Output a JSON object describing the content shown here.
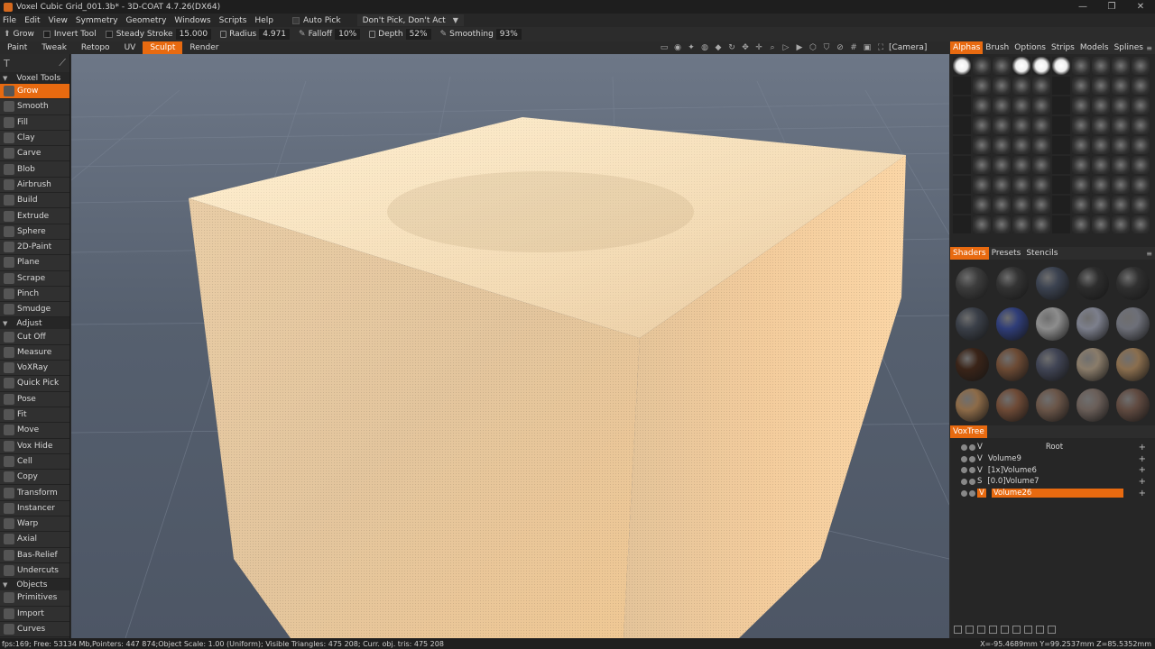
{
  "window": {
    "title": "Voxel Cubic Grid_001.3b* - 3D-COAT 4.7.26(DX64)",
    "controls": [
      "—",
      "❐",
      "✕"
    ]
  },
  "menu": {
    "items": [
      "File",
      "Edit",
      "View",
      "Symmetry",
      "Geometry",
      "Windows",
      "Scripts",
      "Help"
    ],
    "auto_pick": "Auto Pick",
    "pick_mode": "Don't Pick, Don't Act"
  },
  "tool_options": {
    "tool": "Grow",
    "invert_tool": "Invert Tool",
    "steady_stroke_label": "Steady Stroke",
    "steady_stroke_value": "15.000",
    "radius_label": "Radius",
    "radius_value": "4.971",
    "falloff_label": "Falloff",
    "falloff_value": "10%",
    "depth_label": "Depth",
    "depth_value": "52%",
    "smoothing_label": "Smoothing",
    "smoothing_value": "93%"
  },
  "rooms": {
    "tabs": [
      "Paint",
      "Tweak",
      "Retopo",
      "UV",
      "Sculpt",
      "Render"
    ],
    "active": "Sculpt",
    "camera_label": "[Camera]"
  },
  "left_panel": {
    "voxel_tools_header": "Voxel Tools",
    "voxel_tools": [
      "Grow",
      "Smooth",
      "Fill",
      "Clay",
      "Carve",
      "Blob",
      "Airbrush",
      "Build",
      "Extrude",
      "Sphere",
      "2D-Paint",
      "Plane",
      "Scrape",
      "Pinch",
      "Smudge"
    ],
    "selected_tool": "Grow",
    "adjust_header": "Adjust",
    "adjust_tools": [
      "Cut Off",
      "Measure",
      "VoXRay",
      "Quick Pick",
      "Pose",
      "Fit",
      "Move",
      "Vox Hide",
      "Cell",
      "Copy",
      "Transform",
      "Instancer",
      "Warp",
      "Axial",
      "Bas-Relief",
      "Undercuts"
    ],
    "objects_header": "Objects",
    "object_tools": [
      "Primitives",
      "Import",
      "Curves"
    ]
  },
  "right_panel": {
    "top_tabs": [
      "Alphas",
      "Brush",
      "Options",
      "Strips",
      "Models",
      "Splines"
    ],
    "top_active": "Alphas",
    "mid_tabs": [
      "Shaders",
      "Presets",
      "Stencils"
    ],
    "mid_active": "Shaders",
    "voxtree_tab": "VoxTree",
    "voxtree": [
      {
        "flag": "V",
        "name": "Root",
        "root": true
      },
      {
        "flag": "V",
        "name": "Volume9"
      },
      {
        "flag": "V",
        "name": "[1x]Volume6"
      },
      {
        "flag": "S",
        "name": "[0.0]Volume7"
      },
      {
        "flag": "V",
        "name": "Volume26",
        "selected": true
      }
    ],
    "shader_colors": [
      "#3c3c3c",
      "#333333",
      "#3b4250",
      "#2d2d2d",
      "#303030",
      "#3a3f48",
      "#2f3d78",
      "#8d8d8d",
      "#7c7f8c",
      "#6d6f78",
      "#3a2418",
      "#6c4a34",
      "#404454",
      "#8a7c6a",
      "#8a6e4e",
      "#8d6b48",
      "#6e4a36",
      "#6a5548",
      "#6a5e58",
      "#604a40"
    ]
  },
  "status": {
    "left": "fps:169;   Free: 53134 Mb,Pointers: 447 874;Object Scale: 1.00 (Uniform); Visible Triangles: 475 208; Curr. obj. tris: 475 208",
    "right": "X=-95.4689mm Y=99.2537mm Z=85.5352mm"
  },
  "colors": {
    "accent": "#e86a10",
    "viewport_bg": "#5b6575",
    "voxel_surface": "#f5cf9c"
  }
}
